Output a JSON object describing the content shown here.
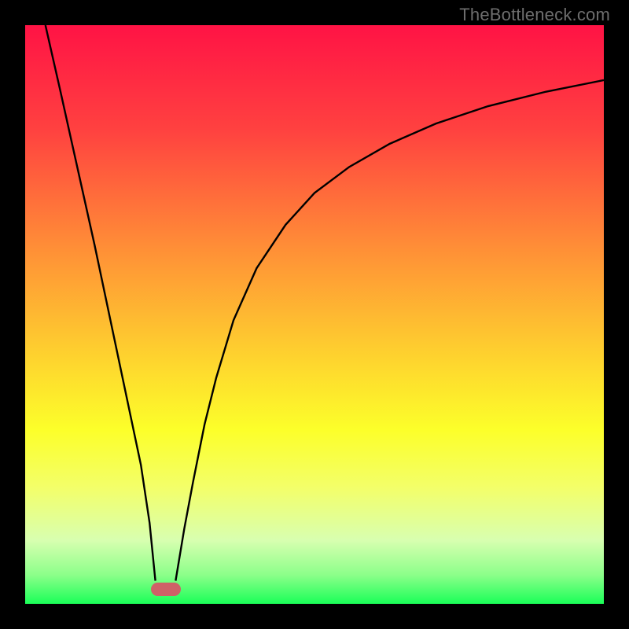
{
  "watermark": "TheBottleneck.com",
  "chart_data": {
    "type": "line",
    "title": "",
    "xlabel": "",
    "ylabel": "",
    "xlim": [
      0,
      100
    ],
    "ylim": [
      0,
      100
    ],
    "grid": false,
    "legend": false,
    "gradient_stops": [
      {
        "offset": 0,
        "color": "#ff1345"
      },
      {
        "offset": 18,
        "color": "#ff4140"
      },
      {
        "offset": 40,
        "color": "#ff9436"
      },
      {
        "offset": 58,
        "color": "#fed52e"
      },
      {
        "offset": 70,
        "color": "#fcff2a"
      },
      {
        "offset": 80,
        "color": "#f3ff6a"
      },
      {
        "offset": 89,
        "color": "#d8ffb0"
      },
      {
        "offset": 95,
        "color": "#8cff8a"
      },
      {
        "offset": 100,
        "color": "#1aff58"
      }
    ],
    "series": [
      {
        "name": "left-curve",
        "x": [
          3.5,
          6,
          8,
          10,
          12,
          14,
          16,
          18,
          20,
          21.5,
          22.5
        ],
        "y": [
          100,
          89,
          80,
          71,
          62,
          52.5,
          43,
          33.5,
          24,
          14,
          4
        ]
      },
      {
        "name": "right-curve",
        "x": [
          26,
          27.5,
          29,
          31,
          33,
          36,
          40,
          45,
          50,
          56,
          63,
          71,
          80,
          90,
          100
        ],
        "y": [
          4,
          13,
          21,
          31,
          39,
          49,
          58,
          65.5,
          71,
          75.5,
          79.5,
          83,
          86,
          88.5,
          90.5
        ]
      }
    ],
    "marker": {
      "x": 24.3,
      "y": 2.5,
      "width_pct": 5.2,
      "height_pct": 2.4,
      "color": "#cf6167"
    }
  }
}
